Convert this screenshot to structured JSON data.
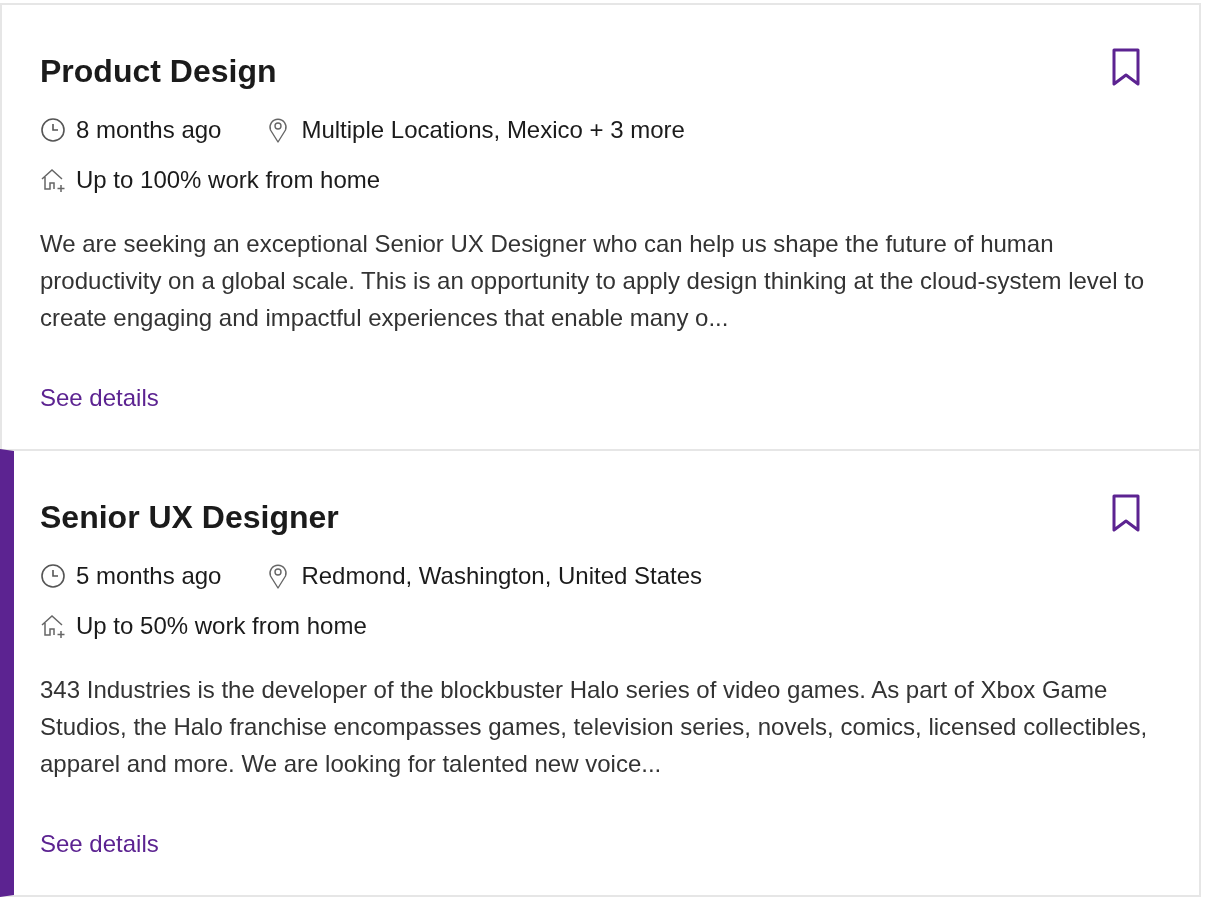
{
  "jobs": [
    {
      "title": "Product Design",
      "posted": "8 months ago",
      "location": "Multiple Locations, Mexico + 3 more",
      "remote": "Up to 100% work from home",
      "description": "We are seeking an exceptional Senior UX Designer who can help us shape the future of human productivity on a global scale. This is an opportunity to apply design thinking at the cloud-system level to create engaging and impactful experiences that enable many o...",
      "link": "See details",
      "selected": false
    },
    {
      "title": "Senior UX Designer",
      "posted": "5 months ago",
      "location": "Redmond, Washington, United States",
      "remote": "Up to 50% work from home",
      "description": "343 Industries is the developer of the blockbuster Halo series of video games. As part of Xbox Game Studios, the Halo franchise encompasses games, television series, novels, comics, licensed collectibles, apparel and more. We are looking for talented new voice...",
      "link": "See details",
      "selected": true
    }
  ]
}
